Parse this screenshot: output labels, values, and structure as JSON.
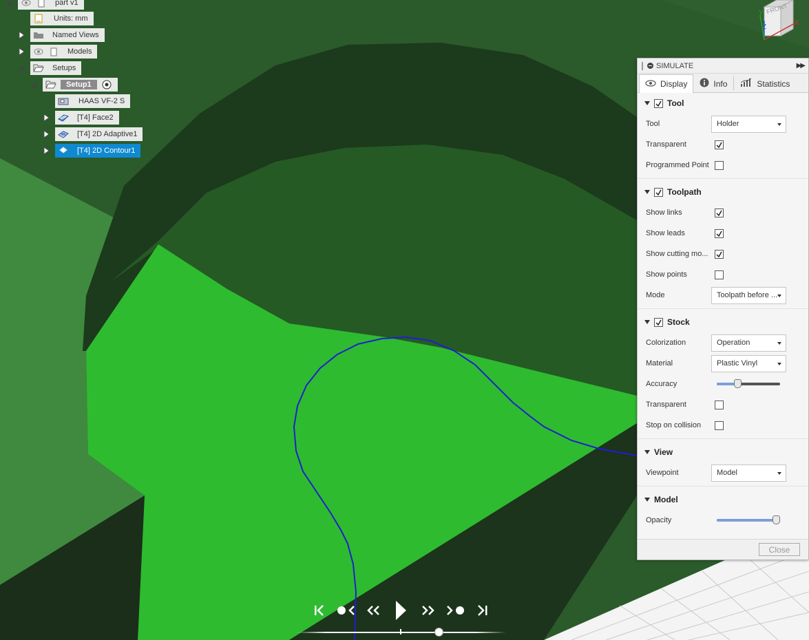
{
  "browser": {
    "root_label": "part v1",
    "units_label": "Units: mm",
    "named_views_label": "Named Views",
    "models_label": "Models",
    "setups_label": "Setups",
    "setup_label": "Setup1",
    "machine_label": "HAAS VF-2 S",
    "ops": [
      "[T4] Face2",
      "[T4] 2D Adaptive1",
      "[T4] 2D Contour1"
    ]
  },
  "viewcube": {
    "face_label": "FRONT",
    "axis_x": "X",
    "axis_y": "Y",
    "axis_z": "Z"
  },
  "panel": {
    "title": "SIMULATE",
    "tabs": [
      "Display",
      "Info",
      "Statistics"
    ],
    "tool": {
      "section": "Tool",
      "tool_label": "Tool",
      "tool_value": "Holder",
      "transparent_label": "Transparent",
      "programmed_point_label": "Programmed Point"
    },
    "toolpath": {
      "section": "Toolpath",
      "show_links_label": "Show links",
      "show_leads_label": "Show leads",
      "show_cutting_label": "Show cutting mo...",
      "show_points_label": "Show points",
      "mode_label": "Mode",
      "mode_value": "Toolpath before ..."
    },
    "stock": {
      "section": "Stock",
      "colorization_label": "Colorization",
      "colorization_value": "Operation",
      "material_label": "Material",
      "material_value": "Plastic Vinyl",
      "accuracy_label": "Accuracy",
      "accuracy_level": 0.33,
      "transparent_label": "Transparent",
      "stop_label": "Stop on collision"
    },
    "view": {
      "section": "View",
      "viewpoint_label": "Viewpoint",
      "viewpoint_value": "Model"
    },
    "model": {
      "section": "Model",
      "opacity_label": "Opacity",
      "opacity_level": 1.0
    },
    "close_label": "Close"
  },
  "playback": {
    "position": 0.68
  },
  "colors": {
    "selection": "#0f8ad1",
    "stock_green": "#2fbb2f",
    "toolpath_blue": "#1f1fd0",
    "slider_fill": "#7d9fd9"
  }
}
